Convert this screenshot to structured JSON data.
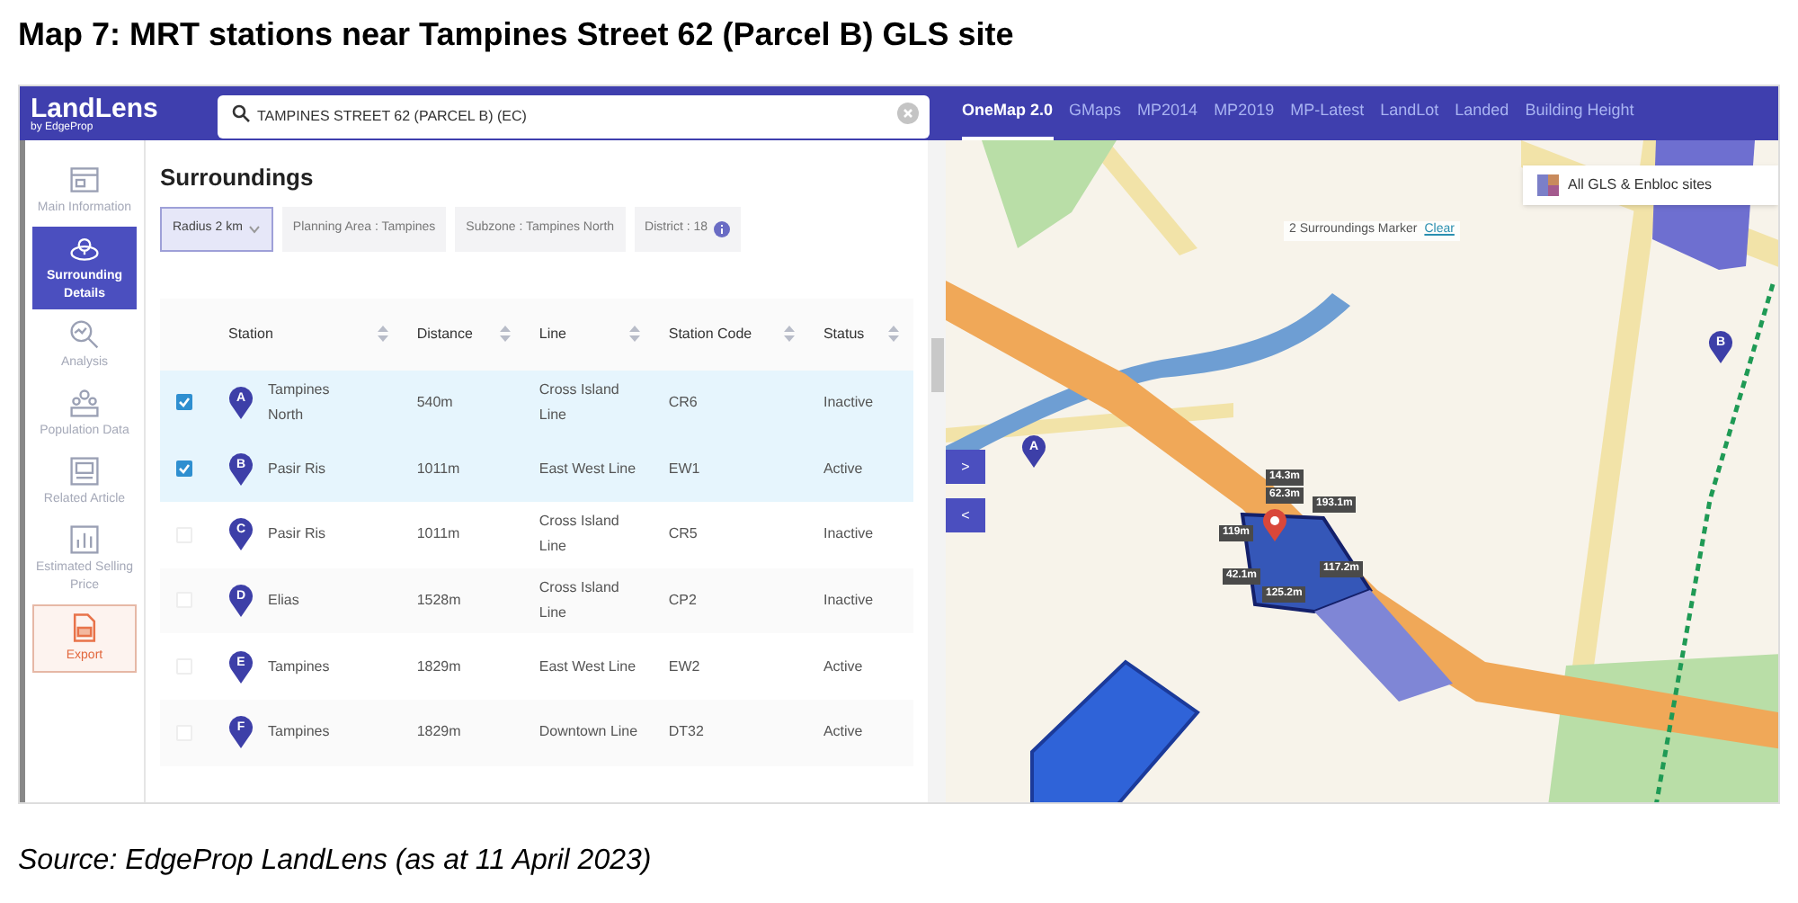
{
  "page_title": "Map 7: MRT stations near Tampines Street 62 (Parcel B) GLS site",
  "app": {
    "logo": "LandLens",
    "logo_sub": "by EdgeProp",
    "search": {
      "value": "TAMPINES STREET 62 (PARCEL B) (EC)"
    },
    "map_tabs": [
      {
        "label": "OneMap 2.0",
        "selected": true
      },
      {
        "label": "GMaps",
        "selected": false
      },
      {
        "label": "MP2014",
        "selected": false
      },
      {
        "label": "MP2019",
        "selected": false
      },
      {
        "label": "MP-Latest",
        "selected": false
      },
      {
        "label": "LandLot",
        "selected": false
      },
      {
        "label": "Landed",
        "selected": false
      },
      {
        "label": "Building Height",
        "selected": false
      }
    ]
  },
  "sidebar": {
    "items": [
      {
        "kind": "info",
        "label": "Main Information",
        "selected": false
      },
      {
        "kind": "surrounding",
        "label": "Surrounding Details",
        "selected": true
      },
      {
        "kind": "analysis",
        "label": "Analysis",
        "selected": false
      },
      {
        "kind": "population",
        "label": "Population Data",
        "selected": false
      },
      {
        "kind": "article",
        "label": "Related Article",
        "selected": false
      },
      {
        "kind": "price",
        "label": "Estimated Selling Price",
        "selected": false
      },
      {
        "kind": "export",
        "label": "Export",
        "selected": false
      }
    ]
  },
  "panel": {
    "title": "Surroundings",
    "filters": [
      {
        "kind": "select",
        "label": "Radius 2 km"
      },
      {
        "kind": "tag",
        "label": "Planning Area : Tampines"
      },
      {
        "kind": "tag",
        "label": "Subzone : Tampines North"
      },
      {
        "kind": "info",
        "label": "District : 18"
      }
    ],
    "table": {
      "columns": [
        "Station",
        "Distance",
        "Line",
        "Station Code",
        "Status"
      ],
      "rows": [
        {
          "checked": true,
          "marker": "A",
          "station": "Tampines North",
          "distance": "540m",
          "line": "Cross Island Line",
          "code": "CR6",
          "status": "Inactive"
        },
        {
          "checked": true,
          "marker": "B",
          "station": "Pasir Ris",
          "distance": "1011m",
          "line": "East West Line",
          "code": "EW1",
          "status": "Active"
        },
        {
          "checked": false,
          "marker": "C",
          "station": "Pasir Ris",
          "distance": "1011m",
          "line": "Cross Island Line",
          "code": "CR5",
          "status": "Inactive"
        },
        {
          "checked": false,
          "marker": "D",
          "station": "Elias",
          "distance": "1528m",
          "line": "Cross Island Line",
          "code": "CP2",
          "status": "Inactive"
        },
        {
          "checked": false,
          "marker": "E",
          "station": "Tampines",
          "distance": "1829m",
          "line": "East West Line",
          "code": "EW2",
          "status": "Active"
        },
        {
          "checked": false,
          "marker": "F",
          "station": "Tampines",
          "distance": "1829m",
          "line": "Downtown Line",
          "code": "DT32",
          "status": "Active"
        }
      ]
    }
  },
  "map": {
    "layer_button": "All GLS & Enbloc sites",
    "markers_note": "2 Surroundings Marker",
    "clear_link": "Clear",
    "expand_button": ">",
    "collapse_button": "<",
    "station_markers": [
      "A",
      "B"
    ],
    "measurements": [
      "14.3m",
      "62.3m",
      "193.1m",
      "119m",
      "42.1m",
      "125.2m",
      "117.2m"
    ]
  },
  "caption": "Source: EdgeProp LandLens (as at 11 April 2023)"
}
